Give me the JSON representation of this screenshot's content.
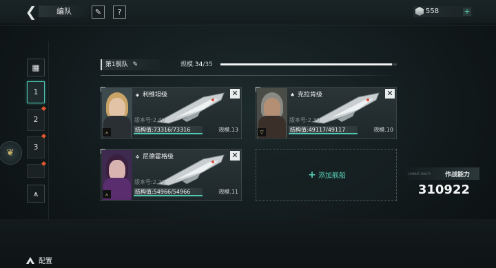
{
  "header": {
    "back_icon": "chevron-left-icon",
    "title": "编队",
    "edit_icon": "quill-icon",
    "help_icon": "question-icon",
    "resource": {
      "icon": "crystal-icon",
      "value": "558",
      "plus": "+"
    }
  },
  "sidebar": {
    "grid_icon": "grid-icon",
    "tabs": [
      {
        "label": "1",
        "active": true,
        "alert": false
      },
      {
        "label": "2",
        "active": false,
        "alert": true
      },
      {
        "label": "3",
        "active": false,
        "alert": true
      }
    ],
    "extra_icon": "radar-icon",
    "emblem_icon": "wing-emblem-icon"
  },
  "fleet": {
    "name": "第1舰队",
    "rename_icon": "pencil-icon",
    "scale_label": "规模.",
    "scale_current": "34",
    "scale_max": "/35",
    "scale_fraction": 0.971
  },
  "ships": [
    {
      "name": "利维坦级",
      "type_glyph": "◈",
      "version": "版本号:2.40",
      "hp": "结构值:73316/73316",
      "scale": "规模.13",
      "close": "✕",
      "class_glyph": "⟑",
      "colors": {
        "hair": "#c9a466",
        "face": "#e3c3a6",
        "body": "#2a2f33",
        "bg": "#3d4a4e"
      }
    },
    {
      "name": "克拉肯级",
      "type_glyph": "♠",
      "version": "版本号:2.30",
      "hp": "结构值:49117/49117",
      "scale": "规模.10",
      "close": "✕",
      "class_glyph": "▽",
      "colors": {
        "hair": "#8a8a84",
        "face": "#b58f74",
        "body": "#3a2f29",
        "bg": "#4a4c48"
      }
    },
    {
      "name": "尼德霍格级",
      "type_glyph": "✲",
      "version": "版本号:2.26",
      "hp": "结构值:54966/54966",
      "scale": "规模.11",
      "close": "✕",
      "class_glyph": "⟑",
      "colors": {
        "hair": "#3a1f3f",
        "face": "#d9b3b0",
        "body": "#5a2d6e",
        "bg": "#3d2a4e"
      }
    }
  ],
  "add_ship": {
    "plus": "+",
    "label": "添加舰船"
  },
  "power": {
    "title": "作战能力",
    "sub": "COMBAT ABILITY",
    "value": "310922"
  },
  "footer": {
    "config_label": "配置",
    "config_icon": "fleet-icon"
  }
}
